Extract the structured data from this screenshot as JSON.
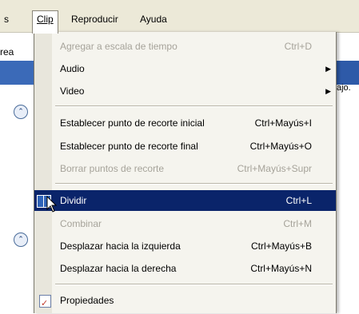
{
  "menubar": {
    "partial_left": "s",
    "items": [
      {
        "label": "Clip",
        "active": true
      },
      {
        "label": "Reproducir",
        "active": false
      },
      {
        "label": "Ayuda",
        "active": false
      }
    ]
  },
  "background": {
    "left_tab_text": "rea",
    "right_text": "ajo."
  },
  "menu": {
    "items": [
      {
        "label": "Agregar a escala de tiempo",
        "accel": "Ctrl+D",
        "disabled": true
      },
      {
        "label": "Audio",
        "accel": "",
        "submenu": true
      },
      {
        "label": "Video",
        "accel": "",
        "submenu": true
      },
      {
        "label": "Establecer punto de recorte inicial",
        "accel": "Ctrl+Mayús+I"
      },
      {
        "label": "Establecer punto de recorte final",
        "accel": "Ctrl+Mayús+O"
      },
      {
        "label": "Borrar puntos de recorte",
        "accel": "Ctrl+Mayús+Supr",
        "disabled": true
      },
      {
        "label": "Dividir",
        "accel": "Ctrl+L",
        "highlighted": true
      },
      {
        "label": "Combinar",
        "accel": "Ctrl+M",
        "disabled": true
      },
      {
        "label": "Desplazar hacia la izquierda",
        "accel": "Ctrl+Mayús+B"
      },
      {
        "label": "Desplazar hacia la derecha",
        "accel": "Ctrl+Mayús+N"
      },
      {
        "label": "Propiedades",
        "accel": ""
      }
    ]
  },
  "colors": {
    "highlight": "#0a246a",
    "menu_bg": "#f5f4ee",
    "menubar_bg": "#ece9d8",
    "disabled_text": "#a6a39a"
  },
  "icons": {
    "split": "split-clip-icon",
    "properties": "properties-icon",
    "collapse": "collapse-up-icon",
    "submenu": "submenu-arrow-icon",
    "cursor": "mouse-pointer-icon"
  }
}
